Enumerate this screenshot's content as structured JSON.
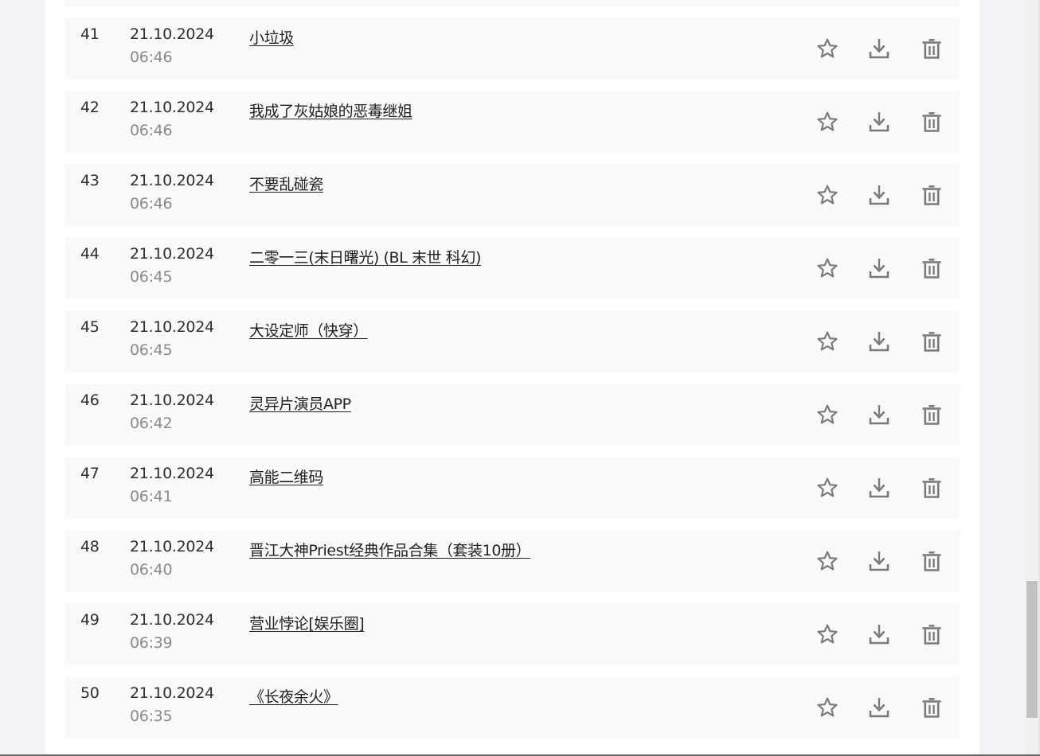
{
  "rows": [
    {
      "num": "41",
      "date": "21.10.2024",
      "time": "06:46",
      "title": "小垃圾"
    },
    {
      "num": "42",
      "date": "21.10.2024",
      "time": "06:46",
      "title": "我成了灰姑娘的恶毒继姐"
    },
    {
      "num": "43",
      "date": "21.10.2024",
      "time": "06:46",
      "title": "不要乱碰瓷"
    },
    {
      "num": "44",
      "date": "21.10.2024",
      "time": "06:45",
      "title": "二零一三(末日曙光) (BL 末世 科幻)"
    },
    {
      "num": "45",
      "date": "21.10.2024",
      "time": "06:45",
      "title": "大设定师（快穿）"
    },
    {
      "num": "46",
      "date": "21.10.2024",
      "time": "06:42",
      "title": "灵异片演员APP"
    },
    {
      "num": "47",
      "date": "21.10.2024",
      "time": "06:41",
      "title": "高能二维码"
    },
    {
      "num": "48",
      "date": "21.10.2024",
      "time": "06:40",
      "title": "晋江大神Priest经典作品合集（套装10册）"
    },
    {
      "num": "49",
      "date": "21.10.2024",
      "time": "06:39",
      "title": "营业悖论[娱乐圈]"
    },
    {
      "num": "50",
      "date": "21.10.2024",
      "time": "06:35",
      "title": "《长夜余火》"
    }
  ],
  "icons": {
    "favorite": "star-icon",
    "download": "download-icon",
    "delete": "trash-icon"
  },
  "colors": {
    "row_background": "#f9f9f9",
    "icon": "#7a7a7a",
    "text": "#2f2f2f",
    "muted_text": "#8a8a8a"
  }
}
